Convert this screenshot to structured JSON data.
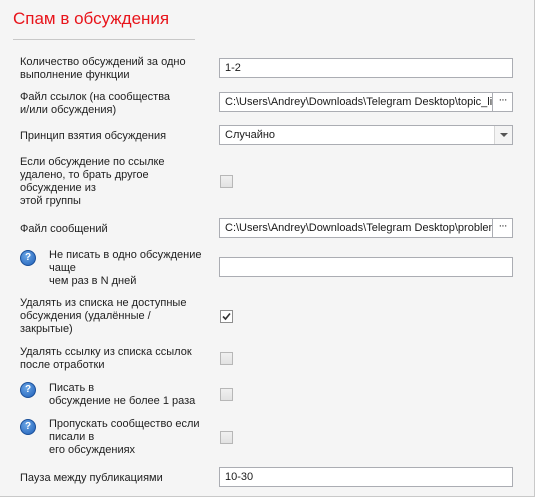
{
  "title": "Спам в обсуждения",
  "fields": {
    "count": {
      "label_l1": "Количество обсуждений за одно",
      "label_l2": "выполнение функции",
      "value": "1-2"
    },
    "links_file": {
      "label_l1": "Файл ссылок (на сообщества",
      "label_l2": "и/или обсуждения)",
      "value": "C:\\Users\\Andrey\\Downloads\\Telegram Desktop\\topic_lin",
      "button": "···"
    },
    "principle": {
      "label": "Принцип взятия обсуждения",
      "selected": "Случайно"
    },
    "deleted_other": {
      "label_l1": "Если обсуждение по ссылке",
      "label_l2": "удалено, то брать другое",
      "label_l3": "обсуждение из",
      "label_l4": "этой группы",
      "checked": false
    },
    "messages_file": {
      "label": "Файл сообщений",
      "value": "C:\\Users\\Andrey\\Downloads\\Telegram Desktop\\problem_",
      "button": "···"
    },
    "not_often": {
      "label_l1": "Не писать в одно обсуждение",
      "label_l2": "чаще",
      "label_l3": "чем раз в N дней",
      "value": ""
    },
    "remove_unavailable": {
      "label_l1": "Удалять из списка не доступные",
      "label_l2": "обсуждения (удалённые /",
      "label_l3": "закрытые)",
      "checked": true
    },
    "remove_link": {
      "label_l1": "Удалять ссылку из списка ссылок",
      "label_l2": "после отработки",
      "checked": false
    },
    "once": {
      "label_l1": "Писать в",
      "label_l2": "обсуждение не более 1 раза",
      "checked": false
    },
    "skip_community": {
      "label_l1": "Пропускать сообщество если",
      "label_l2": "писали в",
      "label_l3": "его обсуждениях",
      "checked": false
    },
    "pause": {
      "label": "Пауза между публикациями",
      "value": "10-30"
    }
  },
  "help_glyph": "?",
  "colors": {
    "title": "#e8141b",
    "help_icon": "#1f5fb8"
  }
}
